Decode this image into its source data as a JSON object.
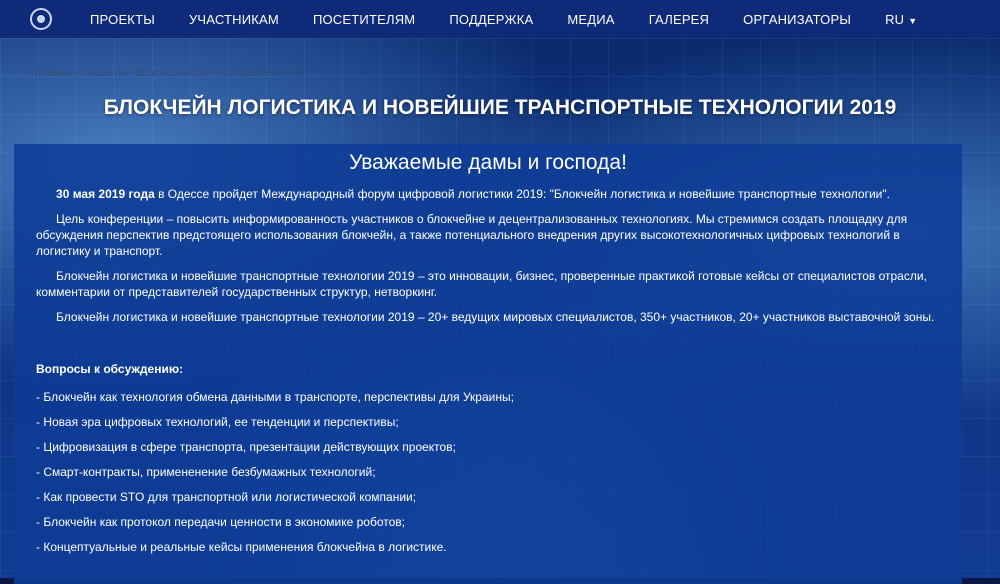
{
  "nav": {
    "items": [
      "ПРОЕКТЫ",
      "УЧАСТНИКАМ",
      "ПОСЕТИТЕЛЯМ",
      "ПОДДЕРЖКА",
      "МЕДИА",
      "ГАЛЕРЕЯ",
      "ОРГАНИЗАТОРЫ"
    ],
    "lang": "RU"
  },
  "breadcrumb": {
    "home": "ГЛАВНАЯ",
    "sep": " - ",
    "projects": "ПРОЕКТЫ",
    "current": "BLOCKCHAINCRYPTO ODESSA 2019"
  },
  "page_title": "БЛОКЧЕЙН ЛОГИСТИКА И НОВЕЙШИЕ ТРАНСПОРТНЫЕ ТЕХНОЛОГИИ 2019",
  "content": {
    "heading": "Уважаемые дамы и господа!",
    "lead_date": "30 мая 2019 года",
    "lead_rest": " в Одессе пройдет Международный форум цифровой логистики 2019: \"Блокчейн логистика и новейшие транспортные технологии\".",
    "p1": "Цель конференции – повысить информированность участников о блокчейне и децентрализованных технологиях. Мы стремимся создать площадку для обсуждения перспектив предстоящего использования блокчейн, а также потенциального внедрения других высокотехнологичных цифровых технологий в логистику и транспорт.",
    "p2": "Блокчейн логистика и новейшие транспортные технологии 2019 – это инновации, бизнес, проверенные практикой готовые кейсы от специалистов отрасли, комментарии от представителей государственных структур, нетворкинг.",
    "p3": "Блокчейн логистика и новейшие транспортные технологии 2019 – 20+ ведущих мировых специалистов, 350+ участников, 20+ участников выставочной зоны.",
    "topics_title": "Вопросы к обсуждению:",
    "topics": [
      "- Блокчейн как технология обмена данными в транспорте, перспективы для Украины;",
      "- Новая эра цифровых технологий, ее тенденции и перспективы;",
      "- Цифровизация в сфере транспорта, презентации действующих проектов;",
      "- Смарт-контракты, примененение  безбумажных технологий;",
      "- Как провести STO для транспортной или логистической компании;",
      "- Блокчейн как протокол передачи ценности в экономике роботов;",
      "- Концептуальные и реальные кейсы применения блокчейна в логистике."
    ]
  }
}
